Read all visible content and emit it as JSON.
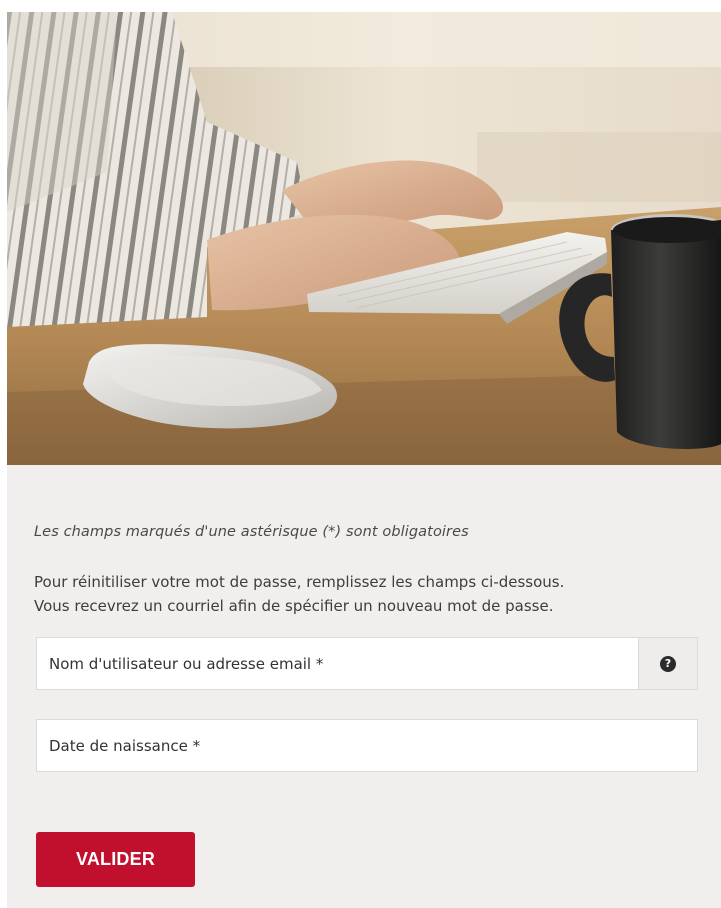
{
  "hero": {
    "image_alt": "person typing on a wireless keyboard next to a smartphone and a coffee mug",
    "colors": {
      "wall": "#e9dfcf",
      "desk": "#b98e5a",
      "keyboard": "#eceae5",
      "mug": "#2e2e2e"
    }
  },
  "form": {
    "required_note": "Les champs marqués d'une astérisque (*) sont obligatoires",
    "instructions": [
      "Pour réinitiliser votre mot de passe, remplissez les champs ci-dessous.",
      "Vous recevrez un courriel afin de spécifier un nouveau mot de passe."
    ],
    "username": {
      "placeholder": "Nom d'utilisateur ou adresse email *",
      "value": "",
      "help_icon": "question-circle-icon"
    },
    "birthdate": {
      "placeholder": "Date de naissance *",
      "value": ""
    },
    "submit_label": "VALIDER",
    "accent_color": "#c1102e",
    "background_color": "#f1efed"
  }
}
